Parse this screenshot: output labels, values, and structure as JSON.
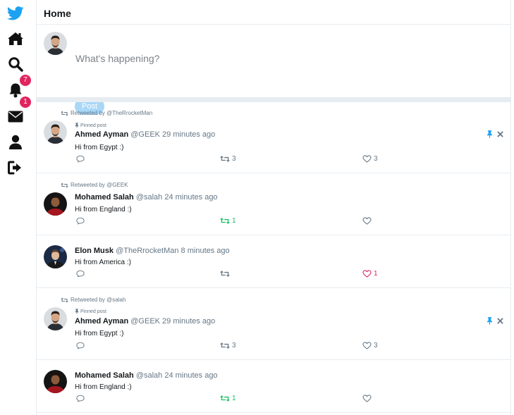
{
  "header": {
    "title": "Home"
  },
  "compose": {
    "placeholder": "What's happening?",
    "post_label": "Post"
  },
  "nav": {
    "notifications_badge": "7",
    "messages_badge": "1"
  },
  "colors": {
    "brand": "#1da1f2",
    "retweet_active": "#17bf63",
    "like_active": "#e0245e",
    "badge": "#e0245e"
  },
  "posts": [
    {
      "retweeted_by": "Retweeted by @TheRrocketMan",
      "pinned": "Pinned post",
      "author": "Ahmed Ayman",
      "meta": "@GEEK 29 minutes ago",
      "text": "Hi from Egypt :)",
      "retweets": "3",
      "likes": "3"
    },
    {
      "retweeted_by": "Retweeted by @GEEK",
      "author": "Mohamed Salah",
      "meta": "@salah 24 minutes ago",
      "text": "Hi from England :)",
      "retweets": "1",
      "likes": ""
    },
    {
      "author": "Elon Musk",
      "meta": "@TheRrocketMan 8 minutes ago",
      "text": "Hi from America :)",
      "retweets": "",
      "likes": "1"
    },
    {
      "retweeted_by": "Retweeted by @salah",
      "pinned": "Pinned post",
      "author": "Ahmed Ayman",
      "meta": "@GEEK 29 minutes ago",
      "text": "Hi from Egypt :)",
      "retweets": "3",
      "likes": "3"
    },
    {
      "author": "Mohamed Salah",
      "meta": "@salah 24 minutes ago",
      "text": "Hi from England :)",
      "retweets": "1",
      "likes": ""
    }
  ]
}
